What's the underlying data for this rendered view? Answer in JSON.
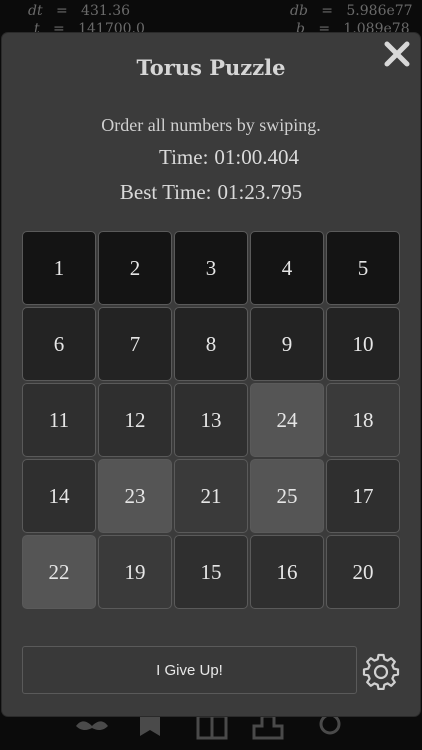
{
  "background_readout": [
    {
      "lhs": "dt",
      "eq": "=",
      "rhs": "431.36"
    },
    {
      "lhs": "db",
      "eq": "=",
      "rhs": "5.986e77"
    },
    {
      "lhs": "t",
      "eq": "=",
      "rhs": "141700.0"
    },
    {
      "lhs": "b",
      "eq": "=",
      "rhs": "1.089e78"
    }
  ],
  "bottom_tabs": [
    {
      "name": "mustache-tab-icon"
    },
    {
      "name": "star-badge-tab-icon"
    },
    {
      "name": "box-tab-icon"
    },
    {
      "name": "podium-tab-icon"
    },
    {
      "name": "gear-tab-icon"
    }
  ],
  "modal": {
    "title": "Torus Puzzle",
    "close_icon": "close-icon",
    "instructions": "Order all numbers by swiping.",
    "time_label": "Time:",
    "time_value": "01:00.404",
    "best_label": "Best Time:",
    "best_value": "01:23.795"
  },
  "board": {
    "rows": 5,
    "cols": 5,
    "tiles": [
      [
        "1",
        "2",
        "3",
        "4",
        "5"
      ],
      [
        "6",
        "7",
        "8",
        "9",
        "10"
      ],
      [
        "11",
        "12",
        "13",
        "24",
        "18"
      ],
      [
        "14",
        "23",
        "21",
        "25",
        "17"
      ],
      [
        "22",
        "19",
        "15",
        "16",
        "20"
      ]
    ],
    "shade_levels": [
      [
        0,
        0,
        0,
        0,
        0
      ],
      [
        1,
        1,
        1,
        1,
        1
      ],
      [
        2,
        2,
        2,
        4,
        3
      ],
      [
        2,
        4,
        3,
        4,
        2
      ],
      [
        4,
        3,
        2,
        2,
        2
      ]
    ],
    "shades": [
      "#141414",
      "#232323",
      "#2f2f2f",
      "#3a3a3a",
      "#555555"
    ]
  },
  "actions": {
    "give_up_label": "I Give Up!",
    "settings_icon": "gear-icon"
  }
}
